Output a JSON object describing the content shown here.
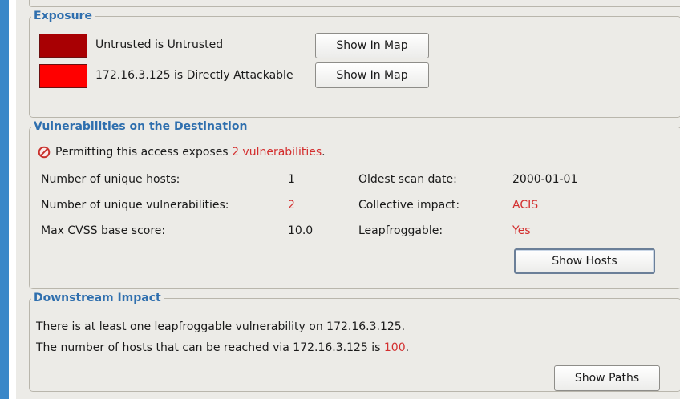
{
  "colors": {
    "accent_bar": "#3a87c8",
    "legend_text": "#2f6fae",
    "highlight_red": "#d32e2e",
    "untrusted_swatch": "#a80003",
    "attackable_swatch": "#ff0000"
  },
  "exposure": {
    "title": "Exposure",
    "items": [
      {
        "color": "#a80003",
        "label": "Untrusted is Untrusted",
        "button": "Show In Map"
      },
      {
        "color": "#ff0000",
        "label": "172.16.3.125 is Directly Attackable",
        "button": "Show In Map"
      }
    ]
  },
  "vulnerabilities": {
    "title": "Vulnerabilities on the Destination",
    "warning_icon": "prohibited-icon",
    "warning_prefix": "Permitting this access exposes ",
    "warning_highlight": "2 vulnerabilities",
    "warning_suffix": ".",
    "rows": [
      {
        "left_label": "Number of unique hosts:",
        "left_value": "1",
        "right_label": "Oldest scan date:",
        "right_value": "2000-01-01"
      },
      {
        "left_label": "Number of unique vulnerabilities:",
        "left_value": "2",
        "right_label": "Collective impact:",
        "right_value": "ACIS"
      },
      {
        "left_label": "Max CVSS base score:",
        "left_value": "10.0",
        "right_label": "Leapfroggable:",
        "right_value": "Yes"
      }
    ],
    "button": "Show Hosts"
  },
  "downstream": {
    "title": "Downstream Impact",
    "line1": "There is at least one leapfroggable vulnerability on 172.16.3.125.",
    "line2_prefix": "The number of hosts that can be reached via 172.16.3.125 is ",
    "line2_highlight": "100",
    "line2_suffix": ".",
    "button": "Show Paths"
  }
}
